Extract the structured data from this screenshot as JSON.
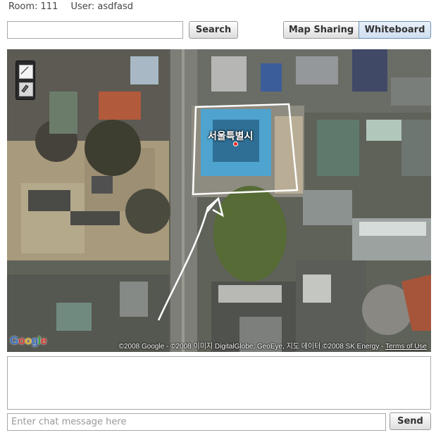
{
  "session": {
    "room_label": "Room: 111",
    "user_label": "User: asdfasd"
  },
  "search": {
    "value": "",
    "placeholder": "",
    "button_label": "Search"
  },
  "mode_tabs": [
    {
      "label": "Map Sharing",
      "active": false
    },
    {
      "label": "Whiteboard",
      "active": true
    }
  ],
  "map": {
    "place_label": "서울특별시",
    "logo_text": "Google",
    "attribution": "©2008 Google - ©2008 이미지 DigitalGlobe, GeoEye, 지도 데이터 ©2008 SK Energy -",
    "terms_link": "Terms of Use",
    "tools": [
      {
        "icon": "pen-icon"
      },
      {
        "icon": "eraser-icon"
      }
    ],
    "annotation_color": "#ffffff"
  },
  "chat": {
    "log_text": "",
    "input_value": "",
    "input_placeholder": "Enter chat message here",
    "send_label": "Send"
  },
  "colors": {
    "active_tab_border": "#6f8fb4",
    "marker": "#e22222"
  }
}
